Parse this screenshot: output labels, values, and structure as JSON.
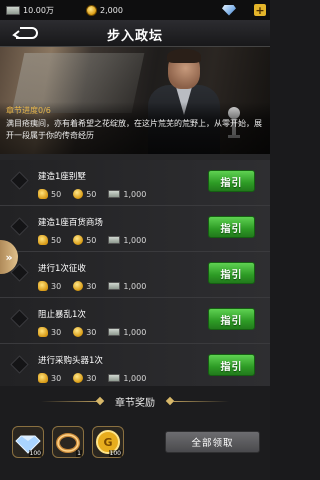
{
  "resources": {
    "cash": "10.00万",
    "coins": "2,000",
    "gems": ""
  },
  "header": {
    "title": "步入政坛"
  },
  "chapter": {
    "progress": "章节进度0/6",
    "description": "满目疮痍间，亦有着希望之花绽放，在这片荒芜的荒野上，从零开始，展开一段属于你的传奇经历"
  },
  "tasks": [
    {
      "name": "建造1座别墅",
      "rewards": [
        "50",
        "50",
        "1,000"
      ],
      "button": "指引"
    },
    {
      "name": "建造1座百货商场",
      "rewards": [
        "50",
        "50",
        "1,000"
      ],
      "button": "指引"
    },
    {
      "name": "进行1次征收",
      "rewards": [
        "30",
        "30",
        "1,000"
      ],
      "button": "指引"
    },
    {
      "name": "阻止暴乱1次",
      "rewards": [
        "30",
        "30",
        "1,000"
      ],
      "button": "指引"
    },
    {
      "name": "进行采购头器1次",
      "rewards": [
        "30",
        "30",
        "1,000"
      ],
      "button": "指引"
    }
  ],
  "side_tab": {
    "label": "»"
  },
  "reward": {
    "title": "章节奖励",
    "items": [
      {
        "icon": "diamond-icon",
        "count": "100"
      },
      {
        "icon": "ring-icon",
        "count": "1"
      },
      {
        "icon": "gold-coin-icon",
        "count": "100"
      }
    ],
    "claim_label": "全部领取"
  },
  "colors": {
    "accent_gold": "#e9b74a",
    "guide_green": "#2d9b25",
    "claim_gray": "#5a5a5d"
  }
}
